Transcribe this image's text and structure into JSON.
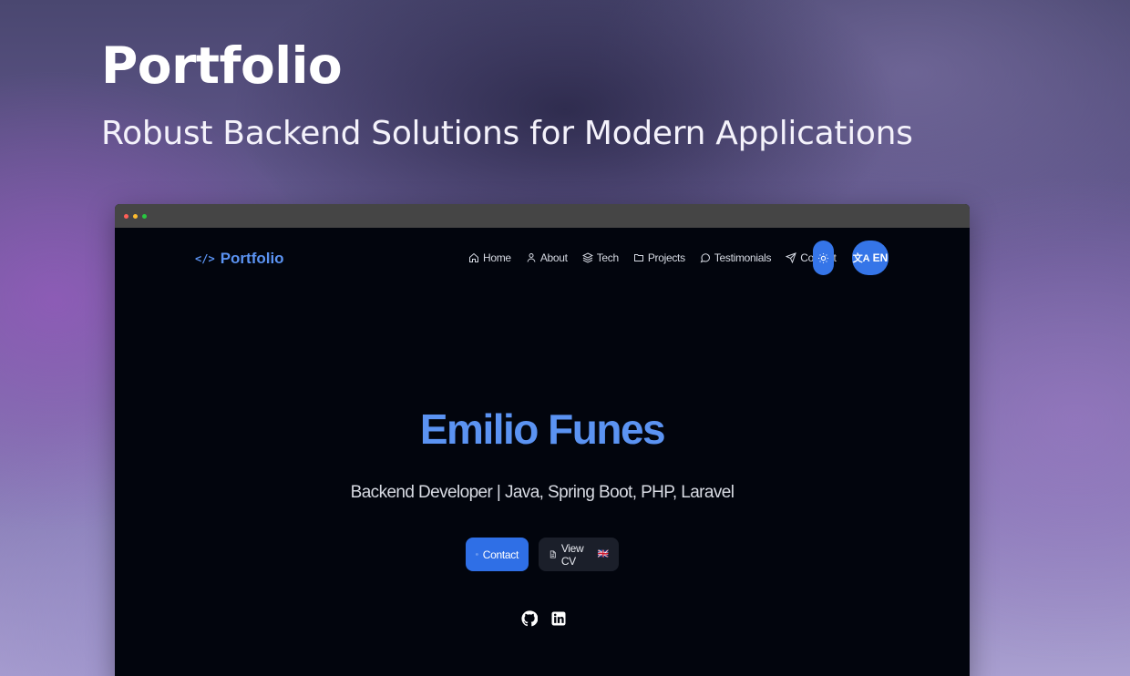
{
  "banner": {
    "title": "Portfolio",
    "subtitle": "Robust Backend Solutions for Modern Applications"
  },
  "site": {
    "brand": {
      "icon_text": "</>",
      "label": "Portfolio",
      "color": "#5b93f2"
    },
    "nav": [
      {
        "label": "Home",
        "icon": "home-icon"
      },
      {
        "label": "About",
        "icon": "user-icon"
      },
      {
        "label": "Tech",
        "icon": "layers-icon"
      },
      {
        "label": "Projects",
        "icon": "folder-icon"
      },
      {
        "label": "Testimonials",
        "icon": "chat-bubble-icon"
      },
      {
        "label": "Contact",
        "icon": "send-icon"
      }
    ],
    "theme_toggle_icon": "sun-icon",
    "language": {
      "glyph": "文A",
      "label": "EN"
    },
    "hero": {
      "name": "Emilio Funes",
      "role": "Backend Developer | Java, Spring Boot, PHP, Laravel",
      "contact_label": "Contact",
      "cv_label": "View CV",
      "cv_flag": "🇬🇧"
    },
    "social": [
      {
        "name": "github-icon"
      },
      {
        "name": "linkedin-icon"
      }
    ],
    "colors": {
      "accent": "#2f6fe6",
      "background": "#02050d"
    }
  }
}
